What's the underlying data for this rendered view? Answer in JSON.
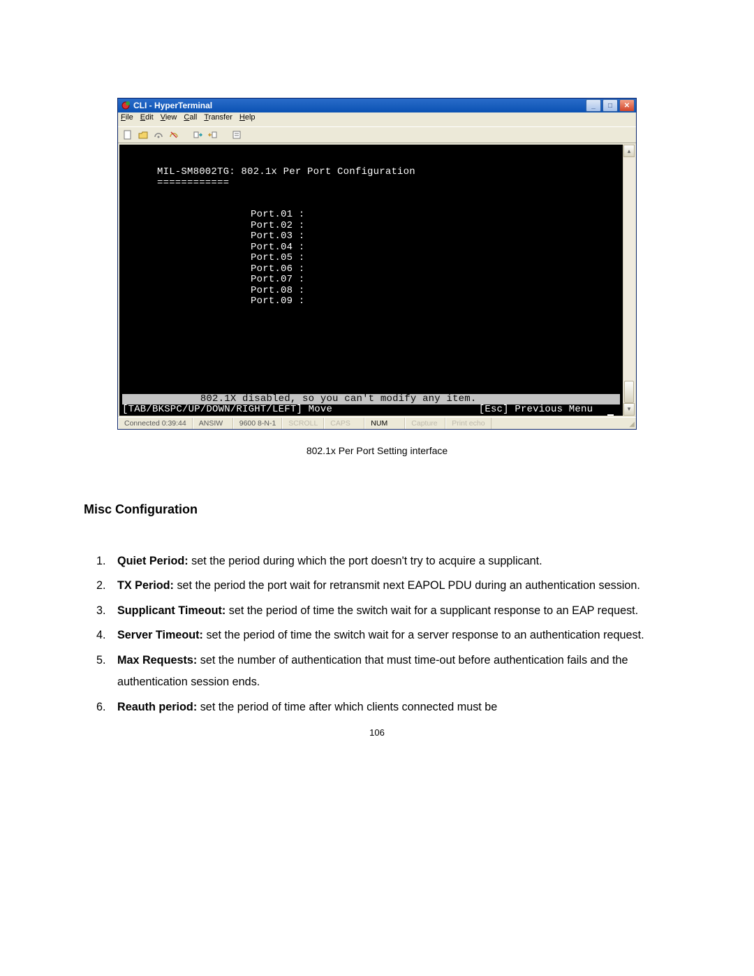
{
  "hyperterminal": {
    "title": "CLI - HyperTerminal",
    "menu": [
      "File",
      "Edit",
      "View",
      "Call",
      "Transfer",
      "Help"
    ],
    "terminal": {
      "header": "MIL-SM8002TG: 802.1x Per Port Configuration",
      "divider": "============",
      "ports": [
        "Port.01 :",
        "Port.02 :",
        "Port.03 :",
        "Port.04 :",
        "Port.05 :",
        "Port.06 :",
        "Port.07 :",
        "Port.08 :",
        "Port.09 :"
      ],
      "message": "802.1X disabled, so you can't modify any item.",
      "nav_left": "[TAB/BKSPC/UP/DOWN/RIGHT/LEFT] Move",
      "nav_right": "[Esc] Previous Menu"
    },
    "status": {
      "connected": "Connected 0:39:44",
      "emulation": "ANSIW",
      "settings": "9600 8-N-1",
      "scroll": "SCROLL",
      "caps": "CAPS",
      "num": "NUM",
      "capture": "Capture",
      "printecho": "Print echo"
    }
  },
  "caption": "802.1x Per Port Setting interface",
  "section_heading": "Misc Configuration",
  "items": [
    {
      "label": "Quiet Period:",
      "text": " set the period during which the port doesn't try to acquire a supplicant."
    },
    {
      "label": "TX Period:",
      "text": " set the period the port wait for retransmit next EAPOL PDU during an authentication session."
    },
    {
      "label": "Supplicant Timeout:",
      "text": " set the period of time the switch wait for a supplicant response to an EAP request."
    },
    {
      "label": "Server Timeout:",
      "text": " set the period of time the switch wait for a server response to an authentication request."
    },
    {
      "label": "Max Requests:",
      "text": " set the number of authentication that must time-out before authentication fails and the authentication session ends."
    },
    {
      "label": "Reauth period:",
      "text": " set the period of time after which clients connected must be"
    }
  ],
  "page_number": "106"
}
